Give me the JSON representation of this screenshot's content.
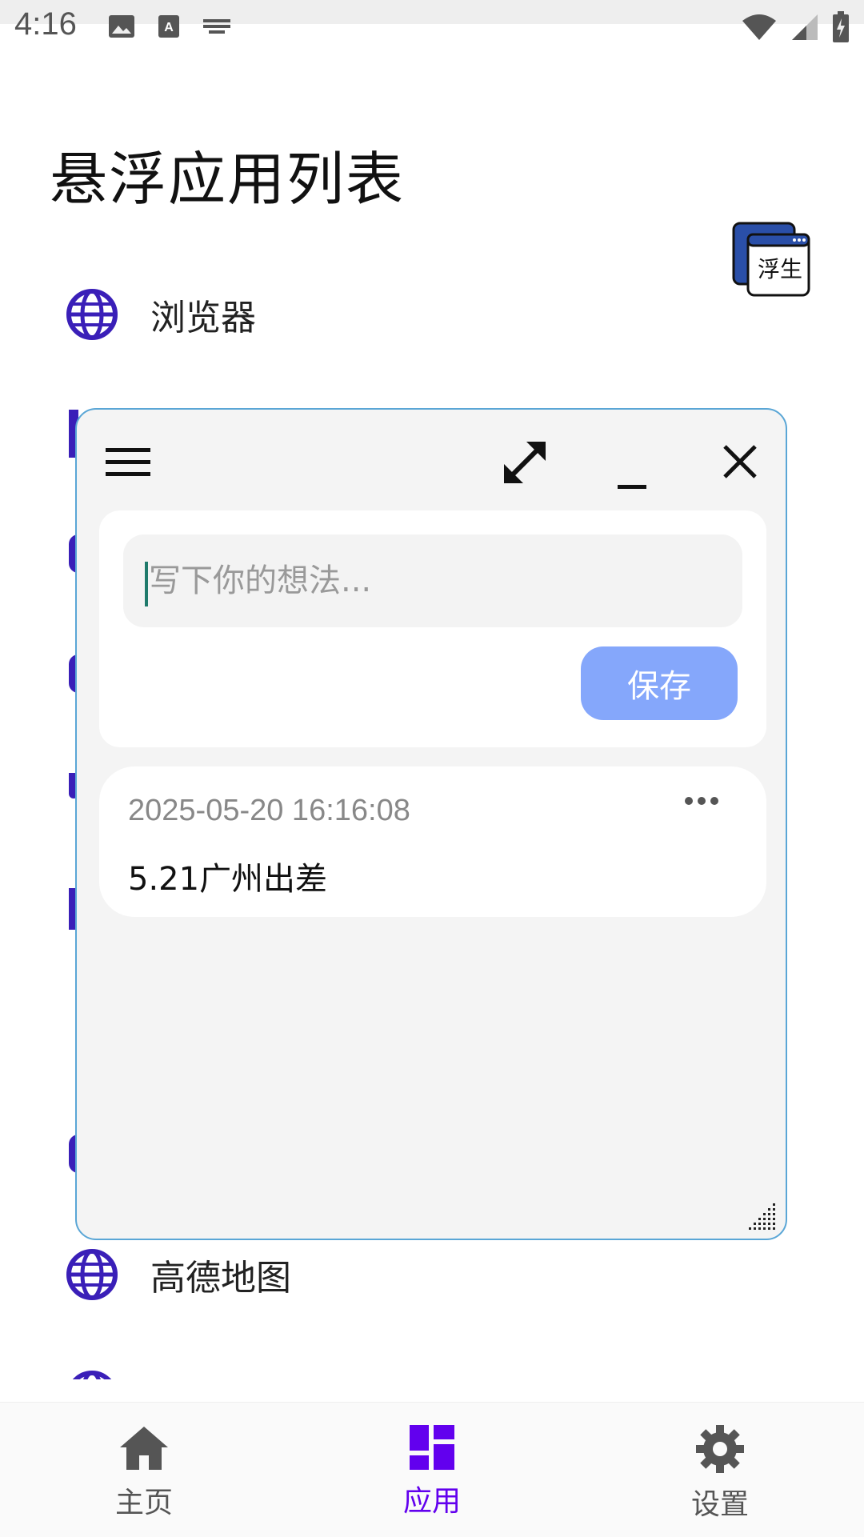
{
  "status_bar": {
    "time": "4:16",
    "left_icons": [
      "image-icon",
      "text-icon",
      "keyboard-icon"
    ],
    "right_icons": [
      "wifi-icon",
      "signal-icon",
      "battery-charging-icon"
    ]
  },
  "page": {
    "title": "悬浮应用列表",
    "badge_text": "浮生"
  },
  "apps": [
    {
      "label": "浏览器",
      "icon": "globe-icon"
    },
    {
      "label": "高德地图",
      "icon": "globe-icon"
    }
  ],
  "floating_window": {
    "toolbar_icons": [
      "menu-icon",
      "expand-icon",
      "minimize-icon",
      "close-icon"
    ],
    "note": {
      "placeholder": "写下你的想法...",
      "value": "",
      "save_label": "保存"
    },
    "entries": [
      {
        "timestamp": "2025-05-20 16:16:08",
        "text": "5.21广州出差"
      }
    ]
  },
  "bottom_nav": {
    "items": [
      {
        "label": "主页",
        "icon": "home-icon",
        "active": false
      },
      {
        "label": "应用",
        "icon": "dashboard-icon",
        "active": true
      },
      {
        "label": "设置",
        "icon": "gear-icon",
        "active": false
      }
    ]
  },
  "colors": {
    "accent": "#6200ee",
    "icon_purple": "#3a1fb8",
    "save_button": "#85a7fb",
    "window_border": "#5aa6d6",
    "nav_inactive": "#555555"
  }
}
